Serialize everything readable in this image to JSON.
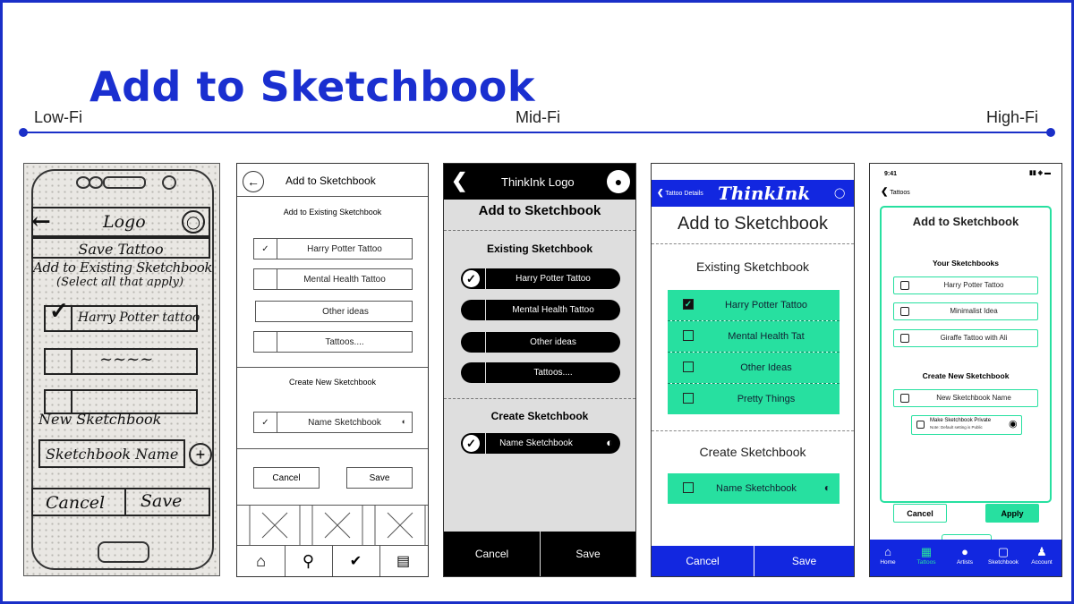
{
  "slide": {
    "title": "Add to Sketchbook",
    "timeline": {
      "left": "Low-Fi",
      "mid": "Mid-Fi",
      "right": "High-Fi"
    }
  },
  "colors": {
    "accent_blue": "#1a2fc8",
    "hifi_blue": "#1227e0",
    "hifi_green": "#27e0a0"
  },
  "lowfi": {
    "logo": "Logo",
    "save": "Save Tattoo",
    "add_existing": "Add to Existing Sketchbook",
    "select_all": "(Select all that apply)",
    "item1": "Harry Potter tattoo",
    "new_sketchbook": "New Sketchbook",
    "sketchbook_name": "Sketchbook Name",
    "cancel": "Cancel",
    "save_btn": "Save"
  },
  "wire": {
    "header": "Add to Sketchbook",
    "section1": "Add to Existing Sketchbook",
    "items": [
      "Harry Potter Tattoo",
      "Mental Health Tattoo",
      "Other ideas",
      "Tattoos...."
    ],
    "section2": "Create New Sketchbook",
    "name": "Name Sketchbook",
    "cancel": "Cancel",
    "save": "Save"
  },
  "dark": {
    "logo": "ThinkInk Logo",
    "title": "Add to Sketchbook",
    "section1": "Existing Sketchbook",
    "items": [
      "Harry Potter Tattoo",
      "Mental Health Tattoo",
      "Other ideas",
      "Tattoos...."
    ],
    "section2": "Create Sketchbook",
    "name": "Name Sketchbook",
    "cancel": "Cancel",
    "save": "Save"
  },
  "hifi1": {
    "back": "Tattoo Details",
    "brand": "ThinkInk",
    "title": "Add to Sketchbook",
    "section1": "Existing Sketchbook",
    "items": [
      "Harry Potter Tattoo",
      "Mental Health Tat",
      "Other Ideas",
      "Pretty Things"
    ],
    "section2": "Create Sketchbook",
    "name": "Name Sketchbook",
    "cancel": "Cancel",
    "save": "Save"
  },
  "hifi2": {
    "time": "9:41",
    "back": "Tattoos",
    "title": "Add to Sketchbook",
    "section1": "Your Sketchbooks",
    "items": [
      "Harry Potter Tattoo",
      "Minimalist Idea",
      "Giraffe Tattoo with Ali"
    ],
    "section2": "Create New Sketchbook",
    "new_name": "New Sketchbook Name",
    "private": "Make Sketchbook Private",
    "private_note": "Note: Default setting is Public",
    "cancel": "Cancel",
    "apply": "Apply",
    "nav": [
      "Home",
      "Tattoos",
      "Artists",
      "Sketchbook",
      "Account"
    ]
  }
}
